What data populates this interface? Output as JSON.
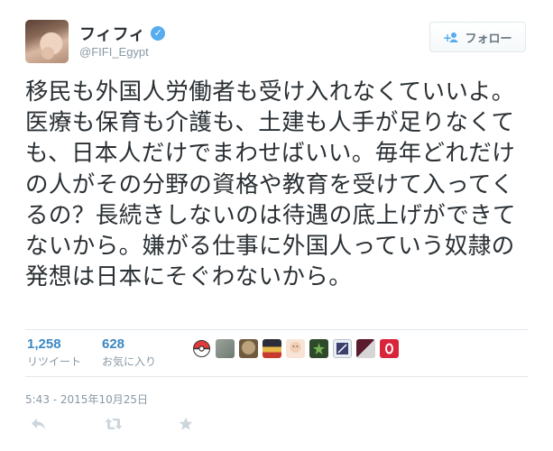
{
  "user": {
    "display_name": "フィフィ",
    "screen_name": "@FIFI_Egypt"
  },
  "follow_button": {
    "label": "フォロー",
    "icon": "person-plus-icon"
  },
  "tweet": {
    "text": "移民も外国人労働者も受け入れなくていいよ。医療も保育も介護も、土建も人手が足りなくても、日本人だけでまわせばいい。毎年どれだけの人がその分野の資格や教育を受けて入ってくるの？長続きしないのは待遇の底上げができてないから。嫌がる仕事に外国人っていう奴隷の発想は日本にそぐわないから。"
  },
  "stats": {
    "retweets": {
      "count": "1,258",
      "label": "リツイート"
    },
    "favorites": {
      "count": "628",
      "label": "お気に入り"
    }
  },
  "timestamp": "5:43 - 2015年10月25日",
  "actions": {
    "reply": "reply-icon",
    "retweet": "retweet-icon",
    "favorite": "star-icon"
  },
  "colors": {
    "link_blue": "#3b88c3",
    "verified_blue": "#55acee",
    "muted": "#8899a6",
    "divider": "#e1e8ed"
  }
}
